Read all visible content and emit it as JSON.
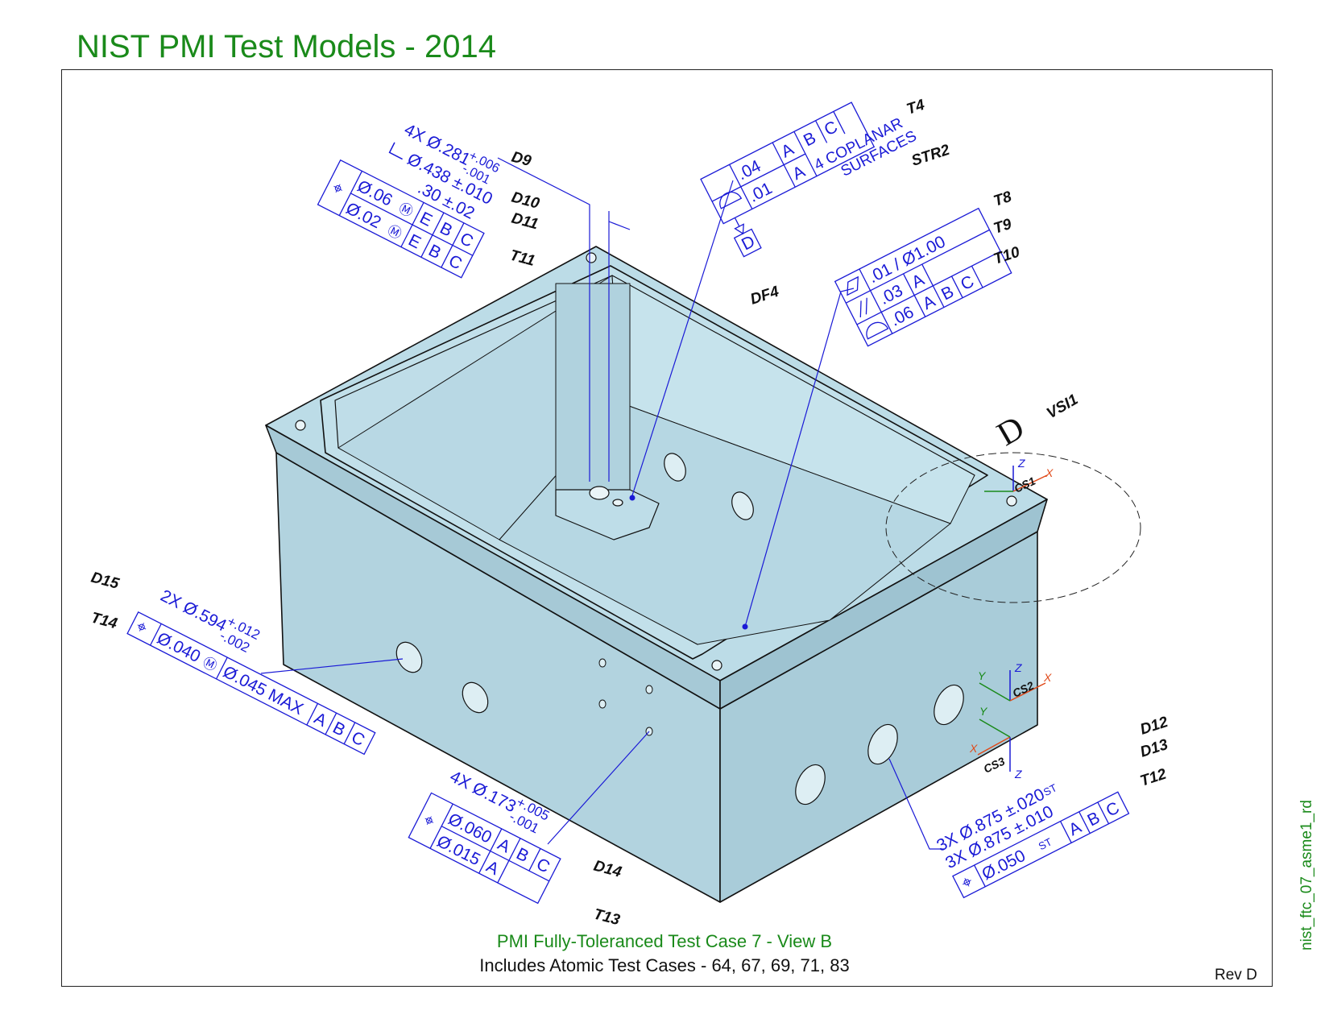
{
  "title": "NIST PMI Test Models - 2014",
  "caption": {
    "line1": "PMI Fully-Toleranced Test Case 7 - View B",
    "line2": "Includes Atomic Test Cases - 64, 67, 69, 71, 83"
  },
  "revision": "Rev D",
  "file_name": "nist_ftc_07_asme1_rd",
  "colors": {
    "title": "#1a8a1a",
    "annotation": "#1a1ad6",
    "part": "#b4d6e2"
  },
  "labels": {
    "T4": "T4",
    "STR2": "STR2",
    "D9": "D9",
    "D10": "D10",
    "D11": "D11",
    "T11": "T11",
    "DF4": "DF4",
    "T8": "T8",
    "T9": "T9",
    "T10": "T10",
    "VSI1": "VSI1",
    "D15": "D15",
    "T14": "T14",
    "D14": "D14",
    "T13": "T13",
    "D12": "D12",
    "D13": "D13",
    "T12": "T12"
  },
  "top_left_callout": {
    "line1": "4X Ø.281",
    "tol_upper": "+.006",
    "tol_lower": "-.001",
    "cbore": "Ø.438 ±.010",
    "depth": ".30 ±.02",
    "fcf": [
      {
        "value": "Ø.06",
        "modifier": "M",
        "datums": [
          "E",
          "B",
          "C"
        ]
      },
      {
        "value": "Ø.02",
        "modifier": "M",
        "datums": [
          "E",
          "B",
          "C"
        ]
      }
    ]
  },
  "top_center_callout": {
    "fcf": [
      {
        "value": ".04",
        "datums": [
          "A",
          "B",
          "C"
        ]
      },
      {
        "value": ".01",
        "datums": [
          "A"
        ]
      }
    ],
    "note1": "4 COPLANAR",
    "note2": "SURFACES",
    "datum": "D"
  },
  "right_callout": {
    "fcf": [
      {
        "value": ".01 / Ø1.00",
        "datums": []
      },
      {
        "value": ".03",
        "datums": [
          "A"
        ]
      },
      {
        "value": ".06",
        "datums": [
          "A",
          "B",
          "C"
        ]
      }
    ]
  },
  "datum_target": {
    "letter": "D"
  },
  "coord_systems": {
    "cs1": {
      "name": "CS1",
      "z": "Z",
      "x": "X"
    },
    "cs2": {
      "name": "CS2",
      "z": "Z",
      "x": "X",
      "y": "Y"
    },
    "cs3": {
      "name": "CS3",
      "z": "Z",
      "x": "X",
      "y": "Y"
    }
  },
  "left_callout": {
    "line1": "2X Ø.594",
    "tol_upper": "+.012",
    "tol_lower": "-.002",
    "fcf": {
      "value": "Ø.040",
      "modifier": "M",
      "value2": "Ø.045 MAX",
      "datums": [
        "A",
        "B",
        "C"
      ]
    }
  },
  "bottom_callout": {
    "line1": "4X Ø.173",
    "tol_upper": "+.005",
    "tol_lower": "-.001",
    "fcf": [
      {
        "value": "Ø.060",
        "datums": [
          "A",
          "B",
          "C"
        ]
      },
      {
        "value": "Ø.015",
        "datums": [
          "A"
        ]
      }
    ]
  },
  "bottom_right_callout": {
    "line1": "3X Ø.875 ±.020",
    "line1_mod": "ST",
    "line2": "3X Ø.875 ±.010",
    "fcf": {
      "value": "Ø.050",
      "modifier": "ST",
      "datums": [
        "A",
        "B",
        "C"
      ]
    }
  }
}
